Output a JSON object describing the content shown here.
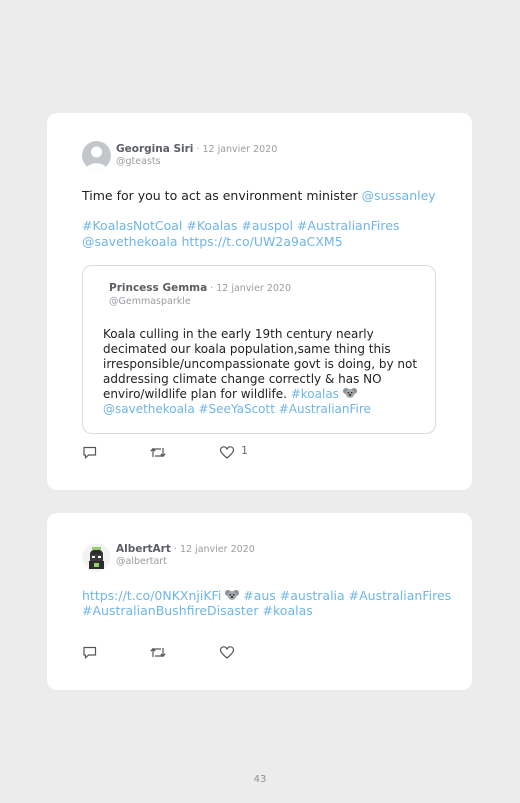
{
  "tweets": [
    {
      "author_name": "Georgina Siri",
      "date": " · 12 janvier 2020",
      "handle": "@gteasts",
      "text_line1": "Time for you to act as environment minister ",
      "mention1": "@sussanley",
      "tags_line1": "#KoalasNotCoal #Koalas #auspol #AustralianFires",
      "tags_line2": "@savethekoala https://t.co/UW2a9aCXM5",
      "quoted": {
        "author_name": "Princess Gemma",
        "date": " · 12 janvier 2020",
        "handle": "@Gemmasparkle",
        "line1": "Koala culling in the early 19th century nearly",
        "line2": "decimated our koala population,same thing this",
        "line3": "irresponsible/uncompassionate govt is doing, by not",
        "line4": "addressing climate change correctly & has NO",
        "line5": "enviro/wildlife plan for wildlife. ",
        "line5_tag": "#koalas",
        "line6": "@savethekoala #SeeYaScott #AustralianFire"
      },
      "like_count": "1"
    },
    {
      "author_name": "AlbertArt",
      "date": " · 12 janvier 2020",
      "handle": "@albertart",
      "link_line1_a": "https://t.co/0NKXnjiKFi",
      "link_line1_b": " #aus #australia #AustralianFires",
      "link_line2": "#AustralianBushfireDisaster #koalas"
    }
  ],
  "icons": {
    "reply": "reply-icon",
    "retweet": "retweet-icon",
    "like": "heart-icon",
    "emoji": "koala-emoji"
  },
  "colors": {
    "link": "#6fb6e6",
    "background": "#ececec",
    "card": "#ffffff"
  },
  "page_number": "43"
}
